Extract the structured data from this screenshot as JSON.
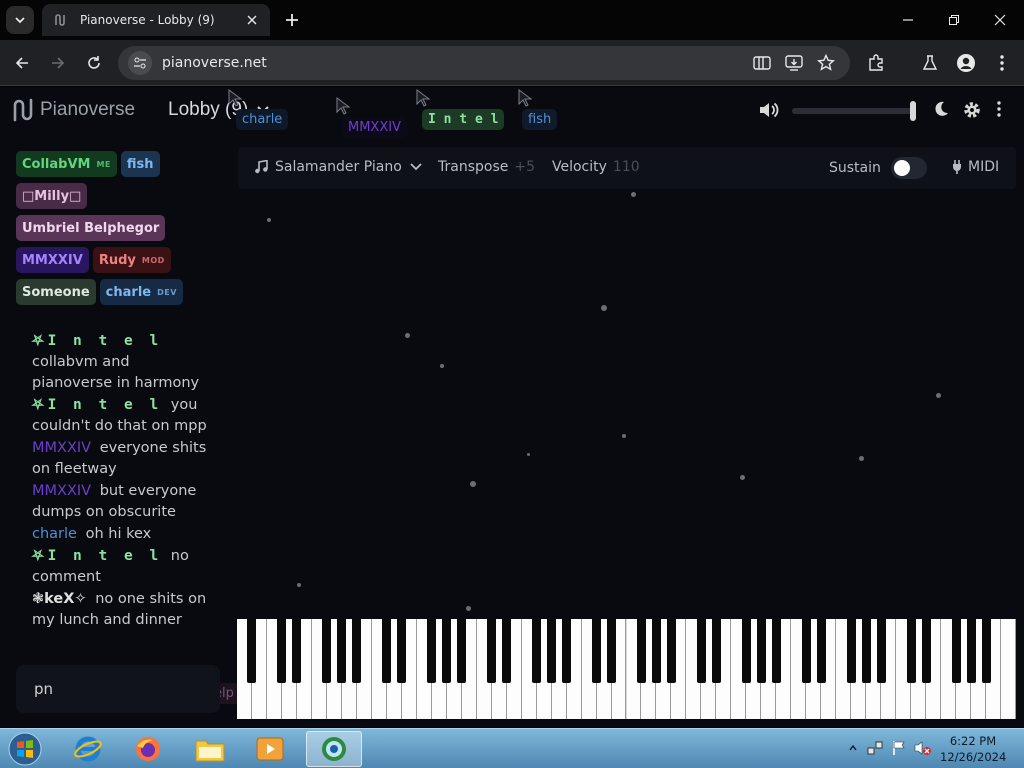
{
  "browser": {
    "tab_title": "Pianoverse - Lobby (9)",
    "url": "pianoverse.net"
  },
  "app": {
    "logo_text": "Pianoverse",
    "room_title": "Lobby (9)",
    "volume_level": 1.0
  },
  "cursors": [
    {
      "label": "charle",
      "color": "#4f8fd6"
    },
    {
      "label": "MMXXIV",
      "color": "#6b3fc9"
    },
    {
      "label": "I n t e l",
      "color": "#8de0a0"
    },
    {
      "label": "fish",
      "color": "#4f8fd6"
    },
    {
      "label": "Umbriel Belp",
      "color": "#c080c0"
    }
  ],
  "users": [
    {
      "name": "CollabVM",
      "tag": "ME",
      "bg": "#123a1f",
      "fg": "#62d67f"
    },
    {
      "name": "fish",
      "tag": "",
      "bg": "#1b3450",
      "fg": "#7fb8ee"
    },
    {
      "name": "□Milly□",
      "tag": "",
      "bg": "#4a2b47",
      "fg": "#e6c1e2"
    },
    {
      "name": "Umbriel Belphegor",
      "tag": "",
      "bg": "#5b3558",
      "fg": "#f0d8ee"
    },
    {
      "name": "MMXXIV",
      "tag": "",
      "bg": "#2a1660",
      "fg": "#a584ff"
    },
    {
      "name": "Rudy",
      "tag": "MOD",
      "bg": "#3a1216",
      "fg": "#f08080"
    },
    {
      "name": "Someone",
      "tag": "",
      "bg": "#2b3a2e",
      "fg": "#dfe8df"
    },
    {
      "name": "charle",
      "tag": "DEV",
      "bg": "#172a45",
      "fg": "#7fb8ee"
    }
  ],
  "chat": [
    {
      "name": "⛧I n t e l",
      "kind": "intel",
      "text": "collabvm and pianoverse in harmony"
    },
    {
      "name": "⛧I n t e l",
      "kind": "intel",
      "text": "you couldn't do that on mpp"
    },
    {
      "name": "MMXXIV",
      "kind": "mmxxiv",
      "text": "everyone shits on fleetway"
    },
    {
      "name": "MMXXIV",
      "kind": "mmxxiv",
      "text": "but everyone dumps on obscurite"
    },
    {
      "name": "charle",
      "kind": "charle",
      "text": "oh hi kex"
    },
    {
      "name": "⛧I n t e l",
      "kind": "intel",
      "text": "no comment"
    },
    {
      "name": "❃keX✧",
      "kind": "kex",
      "text": "no one shits on my lunch and dinner"
    }
  ],
  "chat_input": {
    "value": "pn"
  },
  "controls": {
    "instrument": "Salamander Piano",
    "transpose_label": "Transpose",
    "transpose_value": "+5",
    "velocity_label": "Velocity",
    "velocity_value": "110",
    "sustain_label": "Sustain",
    "midi_label": "MIDI"
  },
  "taskbar": {
    "time": "6:22 PM",
    "date": "12/26/2024"
  }
}
